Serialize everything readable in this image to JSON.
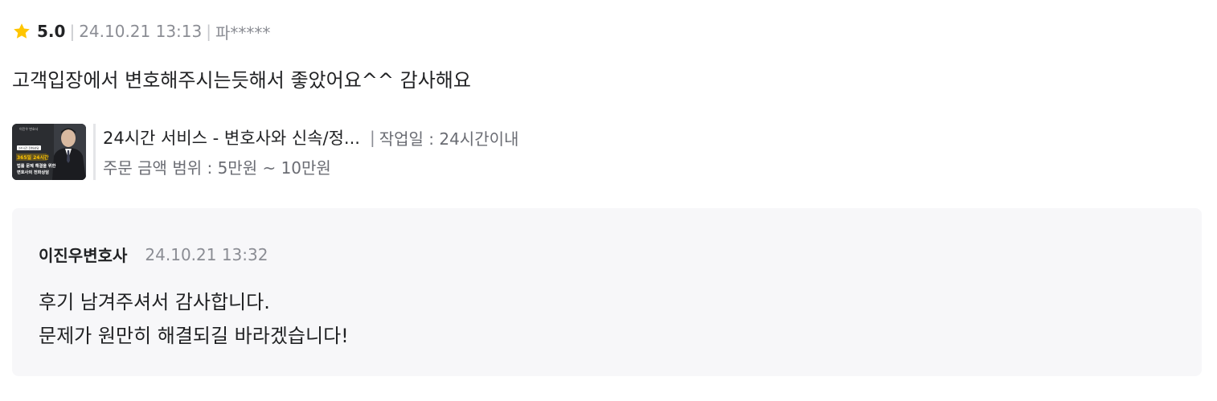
{
  "review": {
    "rating": "5.0",
    "separator": "|",
    "date": "24.10.21 13:13",
    "user": "파*****",
    "text": "고객입장에서 변호해주시는듯해서 좋았어요^^ 감사해요",
    "star_color": "#ffc500"
  },
  "product": {
    "title": "24시간 서비스 - 변호사와 신속/정...",
    "separator": "|",
    "work_period": "작업일 : 24시간이내",
    "price_range": "주문 금액 범위 : 5만원 ~ 10만원",
    "thumbnail": {
      "small_label": "이진우 변호사",
      "badge": "24시간 전화상담",
      "highlight": "365일 24시간",
      "line1": "법률 문제 해결을 위한",
      "line2": "변호사의 전화상담",
      "highlight_color": "#ffc500"
    }
  },
  "reply": {
    "author": "이진우변호사",
    "date": "24.10.21 13:32",
    "lines": [
      "후기 남겨주셔서 감사합니다.",
      "문제가 원만히 해결되길 바라겠습니다!"
    ]
  }
}
